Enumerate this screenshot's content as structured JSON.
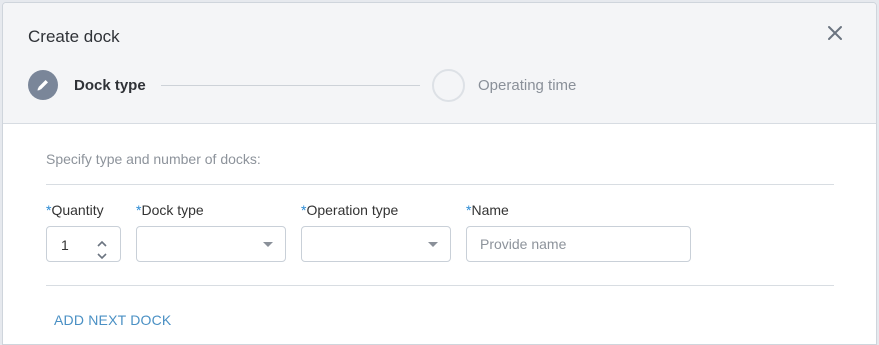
{
  "dialog": {
    "title": "Create dock",
    "close_icon": "close-icon"
  },
  "stepper": {
    "steps": [
      {
        "label": "Dock type",
        "state": "active",
        "icon": "pencil-icon"
      },
      {
        "label": "Operating time",
        "state": "pending"
      }
    ]
  },
  "form": {
    "instruction": "Specify type and number of docks:",
    "required_marker": "*",
    "quantity": {
      "label": "Quantity",
      "value": "1"
    },
    "dock_type": {
      "label": "Dock type",
      "value": ""
    },
    "operation_type": {
      "label": "Operation type",
      "value": ""
    },
    "name": {
      "label": "Name",
      "placeholder": "Provide name",
      "value": ""
    }
  },
  "actions": {
    "add_next_dock": "ADD NEXT DOCK"
  },
  "colors": {
    "accent": "#2a8ad4",
    "link": "#4a90c4",
    "step_active": "#7a8699"
  }
}
